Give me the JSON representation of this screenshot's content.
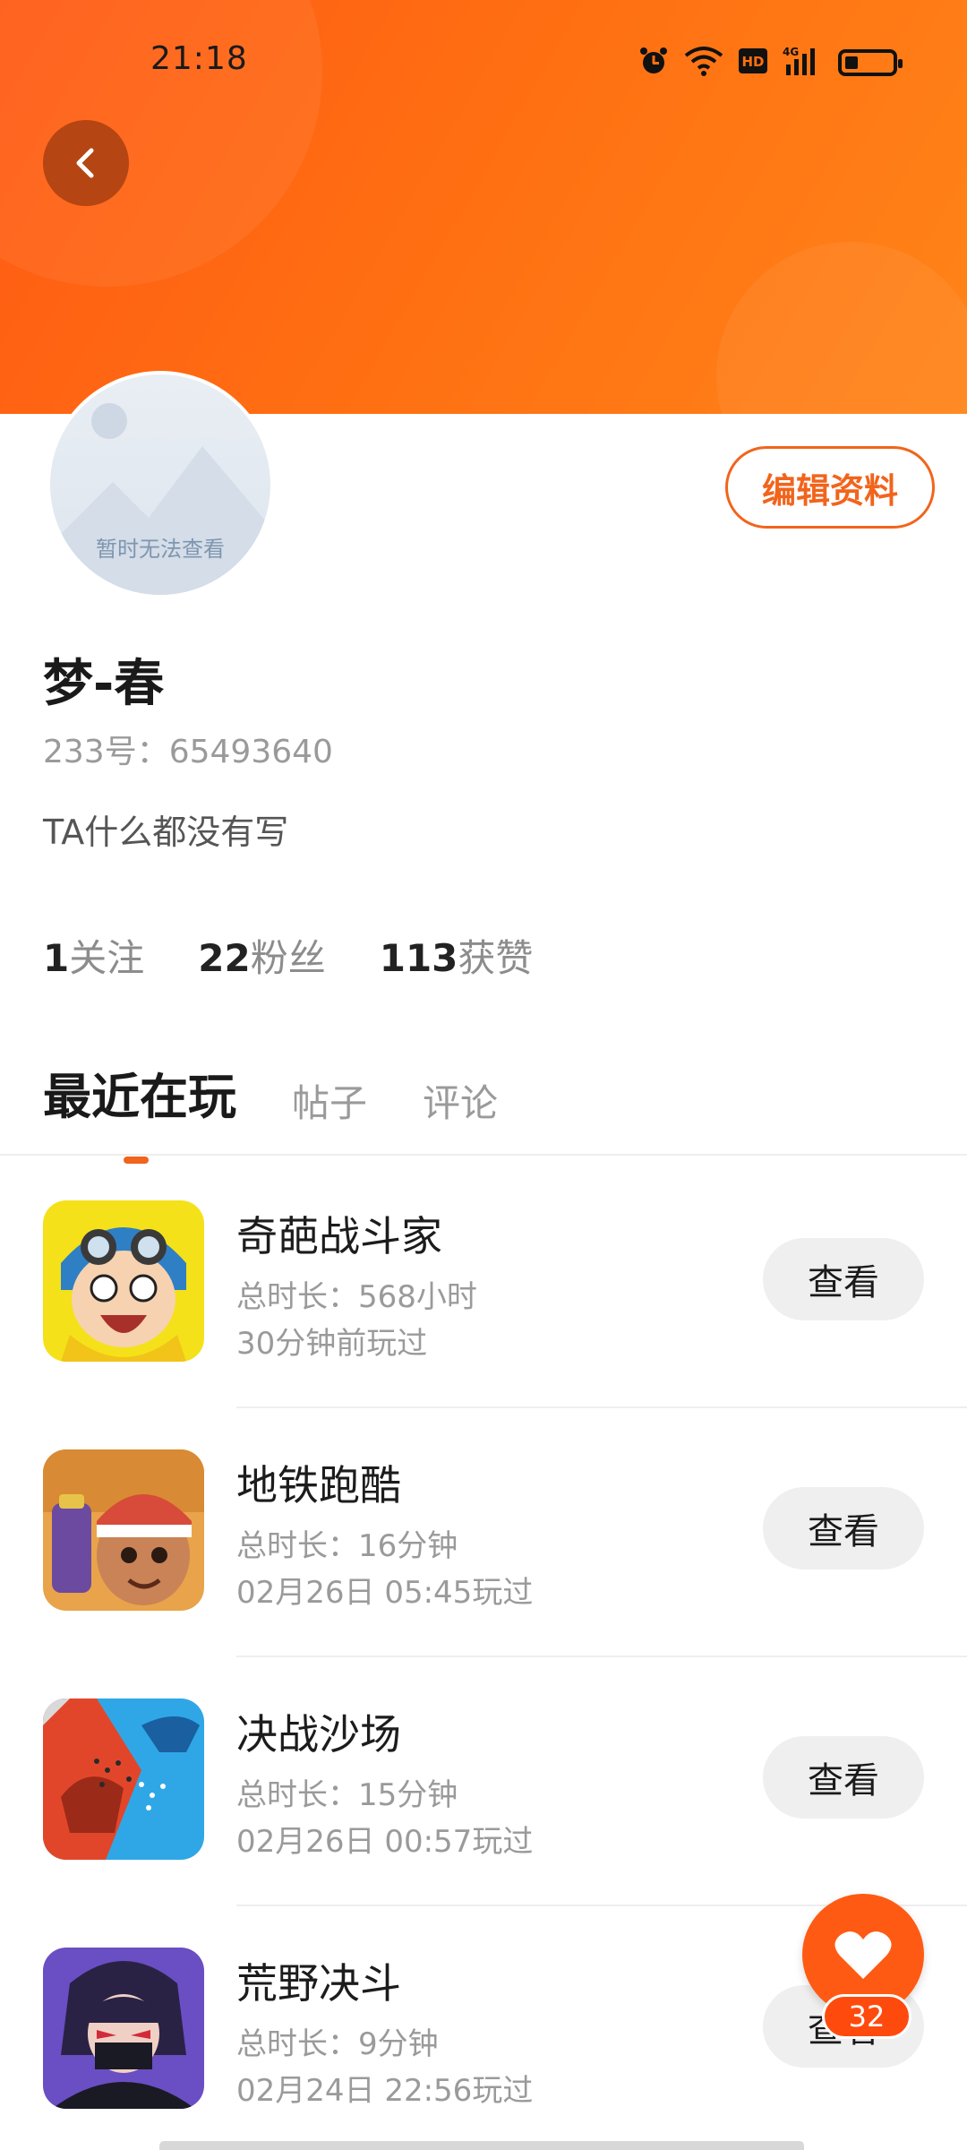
{
  "status_bar": {
    "time": "21:18",
    "icons": [
      "alarm-icon",
      "wifi-icon",
      "hd-icon",
      "4g-signal-icon",
      "battery-icon"
    ]
  },
  "header": {
    "back_icon": "chevron-left-icon",
    "colors": {
      "banner_start": "#ff5a14",
      "banner_end": "#ff8418"
    }
  },
  "profile": {
    "avatar_placeholder": "暂时无法查看",
    "edit_label": "编辑资料",
    "name": "梦-春",
    "uid": "233号：65493640",
    "bio": "TA什么都没有写",
    "stats": [
      {
        "num": "1",
        "label": "关注"
      },
      {
        "num": "22",
        "label": "粉丝"
      },
      {
        "num": "113",
        "label": "获赞"
      }
    ]
  },
  "tabs": [
    {
      "label": "最近在玩",
      "active": true
    },
    {
      "label": "帖子",
      "active": false
    },
    {
      "label": "评论",
      "active": false
    }
  ],
  "games": [
    {
      "title": "奇葩战斗家",
      "total": "总时长：568小时",
      "last": "30分钟前玩过",
      "button": "查看",
      "icon": "game-icon-fighter"
    },
    {
      "title": "地铁跑酷",
      "total": "总时长：16分钟",
      "last": "02月26日 05:45玩过",
      "button": "查看",
      "icon": "game-icon-subway"
    },
    {
      "title": "决战沙场",
      "total": "总时长：15分钟",
      "last": "02月26日 00:57玩过",
      "button": "查看",
      "icon": "game-icon-battle"
    },
    {
      "title": "荒野决斗",
      "total": "总时长：9分钟",
      "last": "02月24日 22:56玩过",
      "button": "查看",
      "icon": "game-icon-wild"
    }
  ],
  "like_fab": {
    "icon": "heart-icon",
    "count": "32"
  },
  "accent_color": "#f1641c"
}
